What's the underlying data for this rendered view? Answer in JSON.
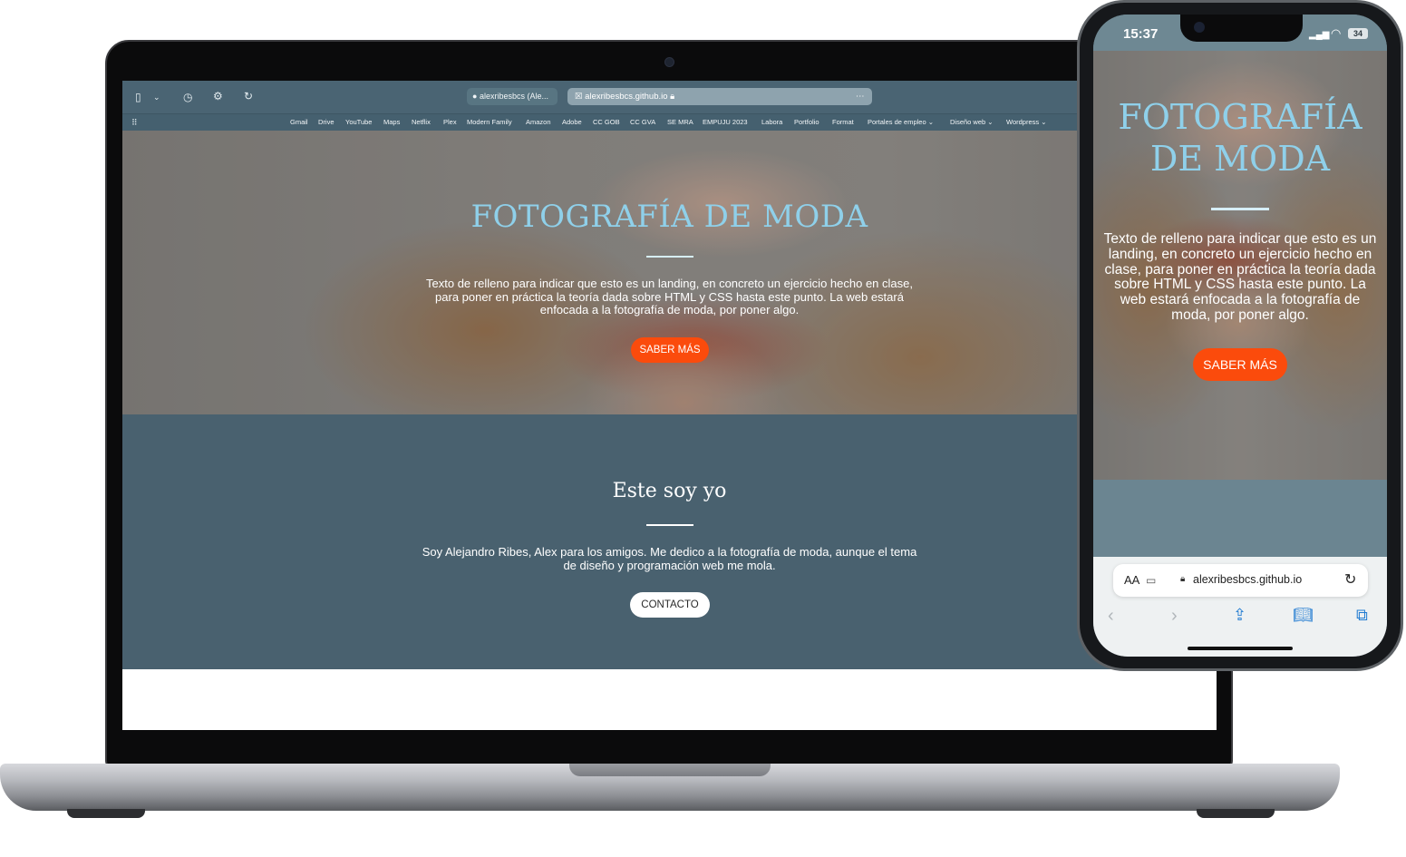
{
  "browser": {
    "tabs": [
      {
        "label": "alexribesbcs (Ale..."
      },
      {
        "label": "alexribesbcs.github.io"
      }
    ],
    "bookmarks": [
      "Gmail",
      "Drive",
      "YouTube",
      "Maps",
      "Netflix",
      "Plex",
      "Modern Family",
      "Amazon",
      "Adobe",
      "CC GOB",
      "CC GVA",
      "SE MRA",
      "EMPUJU 2023",
      "Labora",
      "Portfolio",
      "Format",
      "Portales de empleo ⌄",
      "Diseño web ⌄",
      "Wordpress ⌄"
    ]
  },
  "hero": {
    "title": "FOTOGRAFÍA DE MODA",
    "text": "Texto de relleno para indicar que esto es un landing, en concreto un ejercicio hecho en clase, para poner en práctica la teoría dada sobre HTML y CSS hasta este punto. La web estará enfocada a la fotografía de moda, por poner algo.",
    "button": "SABER MÁS"
  },
  "about": {
    "title": "Este soy yo",
    "text": "Soy Alejandro Ribes, Alex para los amigos. Me dedico a la fotografía de moda, aunque el tema de diseño y programación web me mola.",
    "button": "CONTACTO"
  },
  "phone": {
    "time": "15:37",
    "battery": "34",
    "aa": "AA",
    "url": "alexribesbcs.github.io",
    "hero_title": "FOTOGRAFÍA DE MODA",
    "hero_text": "Texto de relleno para indicar que esto es un landing, en concreto un ejercicio hecho en clase, para poner en práctica la teoría dada sobre HTML y CSS hasta este punto. La web estará enfocada a la fotografía de moda, por poner algo.",
    "hero_button": "SABER MÁS"
  },
  "icons": [
    "sidebar-icon",
    "chevron-down-icon",
    "history-icon",
    "gear-icon",
    "reload-icon",
    "github-icon",
    "close-icon",
    "lock-icon",
    "more-icon",
    "grid-icon",
    "extension-icon",
    "back-icon",
    "forward-icon",
    "share-icon",
    "bookmarks-icon",
    "tabs-icon",
    "wifi-icon",
    "signal-icon"
  ],
  "colors": {
    "accent": "#fb4b0c",
    "title": "#8fd0ea",
    "section_bg": "#49616f"
  }
}
